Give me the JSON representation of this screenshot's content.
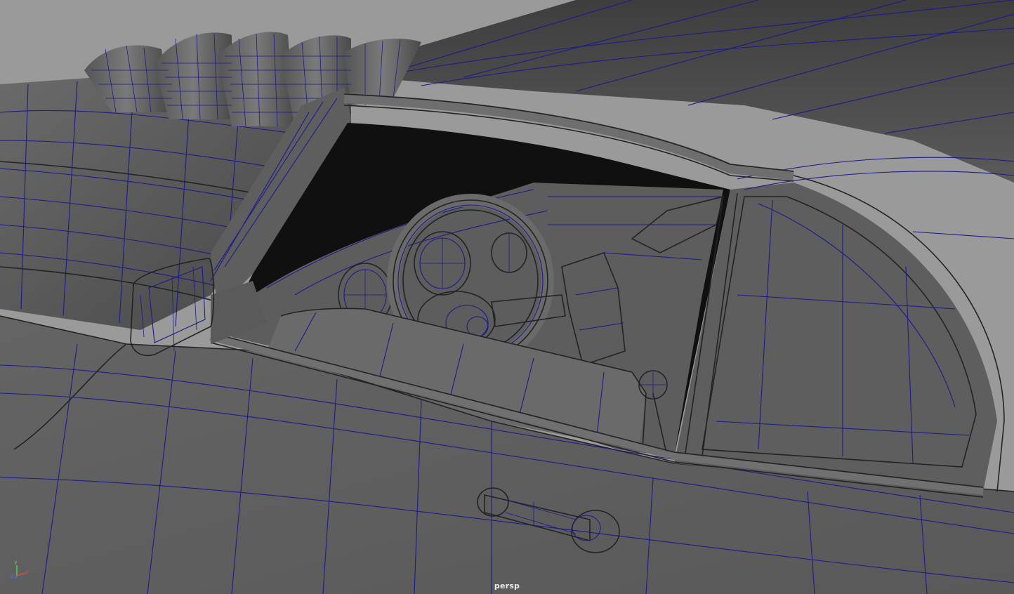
{
  "viewport": {
    "camera_name": "persp",
    "background_color": "#9a9a9a",
    "wireframe_color": "#1d1a8c"
  },
  "axis_gizmo": {
    "y_label": "y",
    "x_label": "x",
    "z_label": "z",
    "y_color": "#4fd04f",
    "x_color": "#e04848",
    "z_color": "#4f6ff0"
  }
}
